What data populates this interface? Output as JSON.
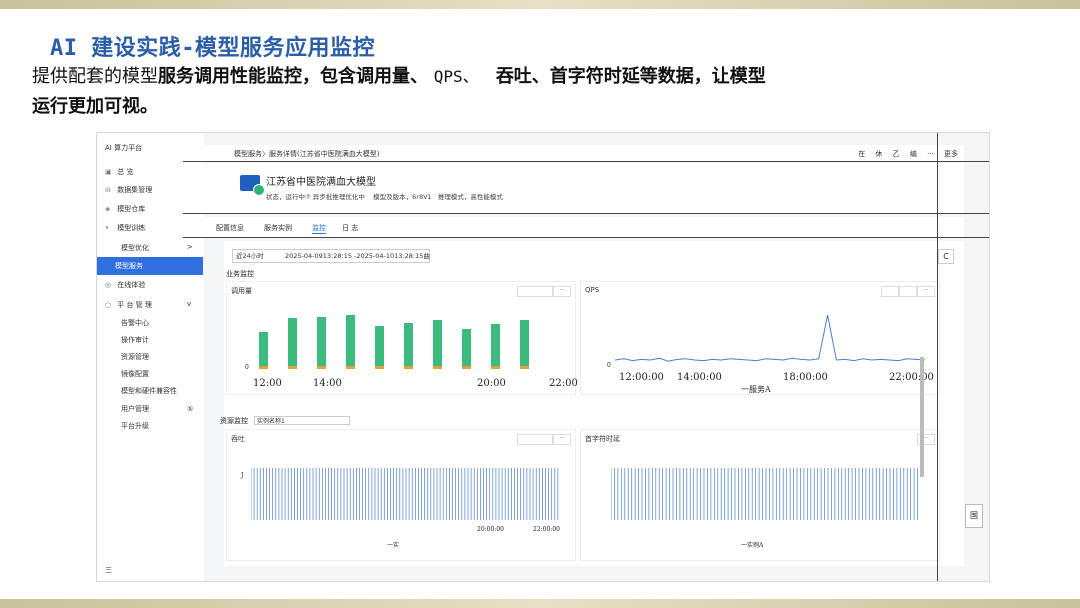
{
  "slide": {
    "title": "AI 建设实践-模型服务应用监控",
    "intro_a": "提供配套的模型",
    "intro_b": "服务调用性能监控，包含调用量、",
    "intro_c": "QPS、",
    "intro_d": "吞吐、首字符时延等数据，让模型",
    "intro_e": "运行更加可视。"
  },
  "sidebar": {
    "app_title": "AI 算力平台",
    "items": [
      {
        "label": "总 览",
        "icon": "grid-icon"
      },
      {
        "label": "数据集管理",
        "icon": "chart-icon"
      },
      {
        "label": "模型仓库",
        "icon": "box-icon"
      },
      {
        "label": "模型训练",
        "icon": "dot-icon"
      },
      {
        "label": "模型优化",
        "icon": ""
      },
      {
        "label": "模型服务",
        "icon": ""
      },
      {
        "label": "在线体验",
        "icon": "chat-icon"
      },
      {
        "label": "平 台 管 理",
        "icon": "ring-icon"
      },
      {
        "label": "告警中心",
        "icon": ""
      },
      {
        "label": "操作审计",
        "icon": ""
      },
      {
        "label": "资源管理",
        "icon": ""
      },
      {
        "label": "镜像配置",
        "icon": ""
      },
      {
        "label": "模型和硬件兼容性",
        "icon": ""
      },
      {
        "label": "用户管理",
        "icon": ""
      },
      {
        "label": "平台升级",
        "icon": ""
      }
    ],
    "footer": "三",
    "chevron": ">",
    "collapse": "v",
    "badge": "⑤"
  },
  "topbar": {
    "breadcrumb": "模型服务〉服务详情(江苏省中医院满血大模型)",
    "right": "在 休 乙 编 ··· 更多"
  },
  "model": {
    "name": "江苏省中医院满血大模型",
    "status": "状态，运行中⑦ 异步批推理优化中",
    "version": "模型及版本，6r8V1",
    "mode": "推理模式，高性能模式"
  },
  "tabs": [
    "配置信息",
    "服务实例",
    "监控",
    "日 志"
  ],
  "active_tab": "监控",
  "monitor": {
    "range_label": "近24小时",
    "range_value": "2025-04-0913:28:15 -2025-04-1013:28:15曲",
    "refresh": "C",
    "section_business": "业务监控",
    "section_resource": "资源监控",
    "instance_select": "实例名称1",
    "charts": {
      "calls": {
        "title": "调用量",
        "btn": "···",
        "ticks": [
          "12:00",
          "14:00",
          "20:00",
          "22:00"
        ],
        "zero": "0"
      },
      "qps": {
        "title": "QPS",
        "btn": "···",
        "ticks": [
          "12:00:00",
          "14:00:00",
          "18:00:00",
          "22:00:00"
        ],
        "legend": "一服务A",
        "zero": "0"
      },
      "throughput": {
        "title": "吞吐",
        "btn": "···",
        "ticks": [
          "20:00:00",
          "22:00:00"
        ],
        "legend": "一实",
        "ymark": "J"
      },
      "ttft": {
        "title": "首字符时延",
        "btn": "···",
        "legend": "一实例A"
      }
    }
  },
  "side_mark": "国",
  "chart_data": [
    {
      "type": "bar",
      "title": "调用量",
      "categories": [
        "12:00",
        "",
        "14:00",
        "",
        "",
        "",
        "",
        "20:00",
        "",
        "22:00"
      ],
      "values": [
        0.55,
        0.77,
        0.79,
        0.82,
        0.64,
        0.7,
        0.74,
        0.6,
        0.68,
        0.75
      ]
    },
    {
      "type": "line",
      "title": "QPS",
      "series": [
        {
          "name": "服务A",
          "values": [
            0.2,
            0.22,
            0.19,
            0.21,
            0.2,
            0.23,
            0.18,
            0.21,
            0.22,
            0.2,
            0.19,
            0.21,
            0.2,
            0.22,
            0.21,
            0.2,
            0.19,
            0.22,
            0.21,
            0.2,
            0.23,
            0.21,
            0.2,
            0.22,
            0.95,
            0.2,
            0.21,
            0.19,
            0.22,
            0.2,
            0.21,
            0.2,
            0.19,
            0.22,
            0.21,
            0.2
          ]
        }
      ]
    }
  ],
  "colors": {
    "accent": "#2f6fe0",
    "bar": "#3dbb7e",
    "bar_base": "#e0a23a",
    "line": "#4a7fc8",
    "title": "#2c5ea8"
  }
}
